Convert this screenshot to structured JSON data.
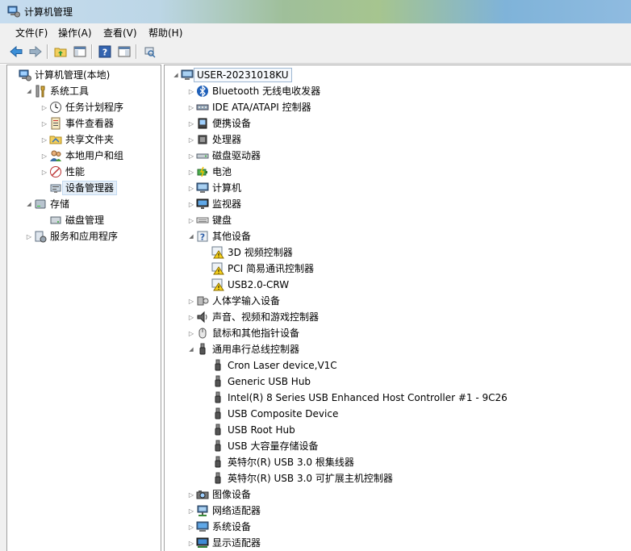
{
  "window": {
    "title": "计算机管理"
  },
  "menu": [
    "文件(F)",
    "操作(A)",
    "查看(V)",
    "帮助(H)"
  ],
  "toolbar": [
    "back-arrow-icon",
    "forward-arrow-icon",
    "up-folder-icon",
    "show-hide-tree-icon",
    "help-icon",
    "properties-icon",
    "scan-hardware-icon"
  ],
  "left_tree": [
    {
      "label": "计算机管理(本地)",
      "icon": "computer-management-icon",
      "depth": 0,
      "expander": "none"
    },
    {
      "label": "系统工具",
      "icon": "tools-icon",
      "depth": 1,
      "expander": "expanded"
    },
    {
      "label": "任务计划程序",
      "icon": "clock-icon",
      "depth": 2,
      "expander": "collapsed"
    },
    {
      "label": "事件查看器",
      "icon": "event-log-icon",
      "depth": 2,
      "expander": "collapsed"
    },
    {
      "label": "共享文件夹",
      "icon": "shared-folder-icon",
      "depth": 2,
      "expander": "collapsed"
    },
    {
      "label": "本地用户和组",
      "icon": "users-icon",
      "depth": 2,
      "expander": "collapsed"
    },
    {
      "label": "性能",
      "icon": "performance-icon",
      "depth": 2,
      "expander": "collapsed"
    },
    {
      "label": "设备管理器",
      "icon": "device-manager-icon",
      "depth": 2,
      "expander": "none",
      "selected": true
    },
    {
      "label": "存储",
      "icon": "storage-icon",
      "depth": 1,
      "expander": "expanded"
    },
    {
      "label": "磁盘管理",
      "icon": "disk-management-icon",
      "depth": 2,
      "expander": "none"
    },
    {
      "label": "服务和应用程序",
      "icon": "services-icon",
      "depth": 1,
      "expander": "collapsed"
    }
  ],
  "device_tree": [
    {
      "label": "USER-20231018KU",
      "icon": "computer-icon",
      "depth": 0,
      "expander": "expanded",
      "root": true
    },
    {
      "label": "Bluetooth 无线电收发器",
      "icon": "bluetooth-icon",
      "depth": 1,
      "expander": "collapsed"
    },
    {
      "label": "IDE ATA/ATAPI 控制器",
      "icon": "ide-controller-icon",
      "depth": 1,
      "expander": "collapsed"
    },
    {
      "label": "便携设备",
      "icon": "portable-device-icon",
      "depth": 1,
      "expander": "collapsed"
    },
    {
      "label": "处理器",
      "icon": "processor-icon",
      "depth": 1,
      "expander": "collapsed"
    },
    {
      "label": "磁盘驱动器",
      "icon": "disk-drive-icon",
      "depth": 1,
      "expander": "collapsed"
    },
    {
      "label": "电池",
      "icon": "battery-icon",
      "depth": 1,
      "expander": "collapsed"
    },
    {
      "label": "计算机",
      "icon": "computer-icon",
      "depth": 1,
      "expander": "collapsed"
    },
    {
      "label": "监视器",
      "icon": "monitor-icon",
      "depth": 1,
      "expander": "collapsed"
    },
    {
      "label": "键盘",
      "icon": "keyboard-icon",
      "depth": 1,
      "expander": "collapsed"
    },
    {
      "label": "其他设备",
      "icon": "unknown-device-icon",
      "depth": 1,
      "expander": "expanded"
    },
    {
      "label": "3D 视频控制器",
      "icon": "warning-device-icon",
      "depth": 2,
      "expander": "none"
    },
    {
      "label": "PCI 简易通讯控制器",
      "icon": "warning-device-icon",
      "depth": 2,
      "expander": "none"
    },
    {
      "label": "USB2.0-CRW",
      "icon": "warning-device-icon",
      "depth": 2,
      "expander": "none"
    },
    {
      "label": "人体学输入设备",
      "icon": "hid-icon",
      "depth": 1,
      "expander": "collapsed"
    },
    {
      "label": "声音、视频和游戏控制器",
      "icon": "speaker-icon",
      "depth": 1,
      "expander": "collapsed"
    },
    {
      "label": "鼠标和其他指针设备",
      "icon": "mouse-icon",
      "depth": 1,
      "expander": "collapsed"
    },
    {
      "label": "通用串行总线控制器",
      "icon": "usb-icon",
      "depth": 1,
      "expander": "expanded"
    },
    {
      "label": "Cron Laser device,V1C",
      "icon": "usb-icon",
      "depth": 2,
      "expander": "none"
    },
    {
      "label": "Generic USB Hub",
      "icon": "usb-icon",
      "depth": 2,
      "expander": "none"
    },
    {
      "label": "Intel(R) 8 Series USB Enhanced Host Controller #1 - 9C26",
      "icon": "usb-icon",
      "depth": 2,
      "expander": "none"
    },
    {
      "label": "USB Composite Device",
      "icon": "usb-icon",
      "depth": 2,
      "expander": "none"
    },
    {
      "label": "USB Root Hub",
      "icon": "usb-icon",
      "depth": 2,
      "expander": "none"
    },
    {
      "label": "USB 大容量存储设备",
      "icon": "usb-icon",
      "depth": 2,
      "expander": "none"
    },
    {
      "label": "英特尔(R) USB 3.0 根集线器",
      "icon": "usb-icon",
      "depth": 2,
      "expander": "none"
    },
    {
      "label": "英特尔(R) USB 3.0 可扩展主机控制器",
      "icon": "usb-icon",
      "depth": 2,
      "expander": "none"
    },
    {
      "label": "图像设备",
      "icon": "camera-icon",
      "depth": 1,
      "expander": "collapsed"
    },
    {
      "label": "网络适配器",
      "icon": "network-adapter-icon",
      "depth": 1,
      "expander": "collapsed"
    },
    {
      "label": "系统设备",
      "icon": "system-device-icon",
      "depth": 1,
      "expander": "collapsed"
    },
    {
      "label": "显示适配器",
      "icon": "display-adapter-icon",
      "depth": 1,
      "expander": "collapsed"
    }
  ]
}
